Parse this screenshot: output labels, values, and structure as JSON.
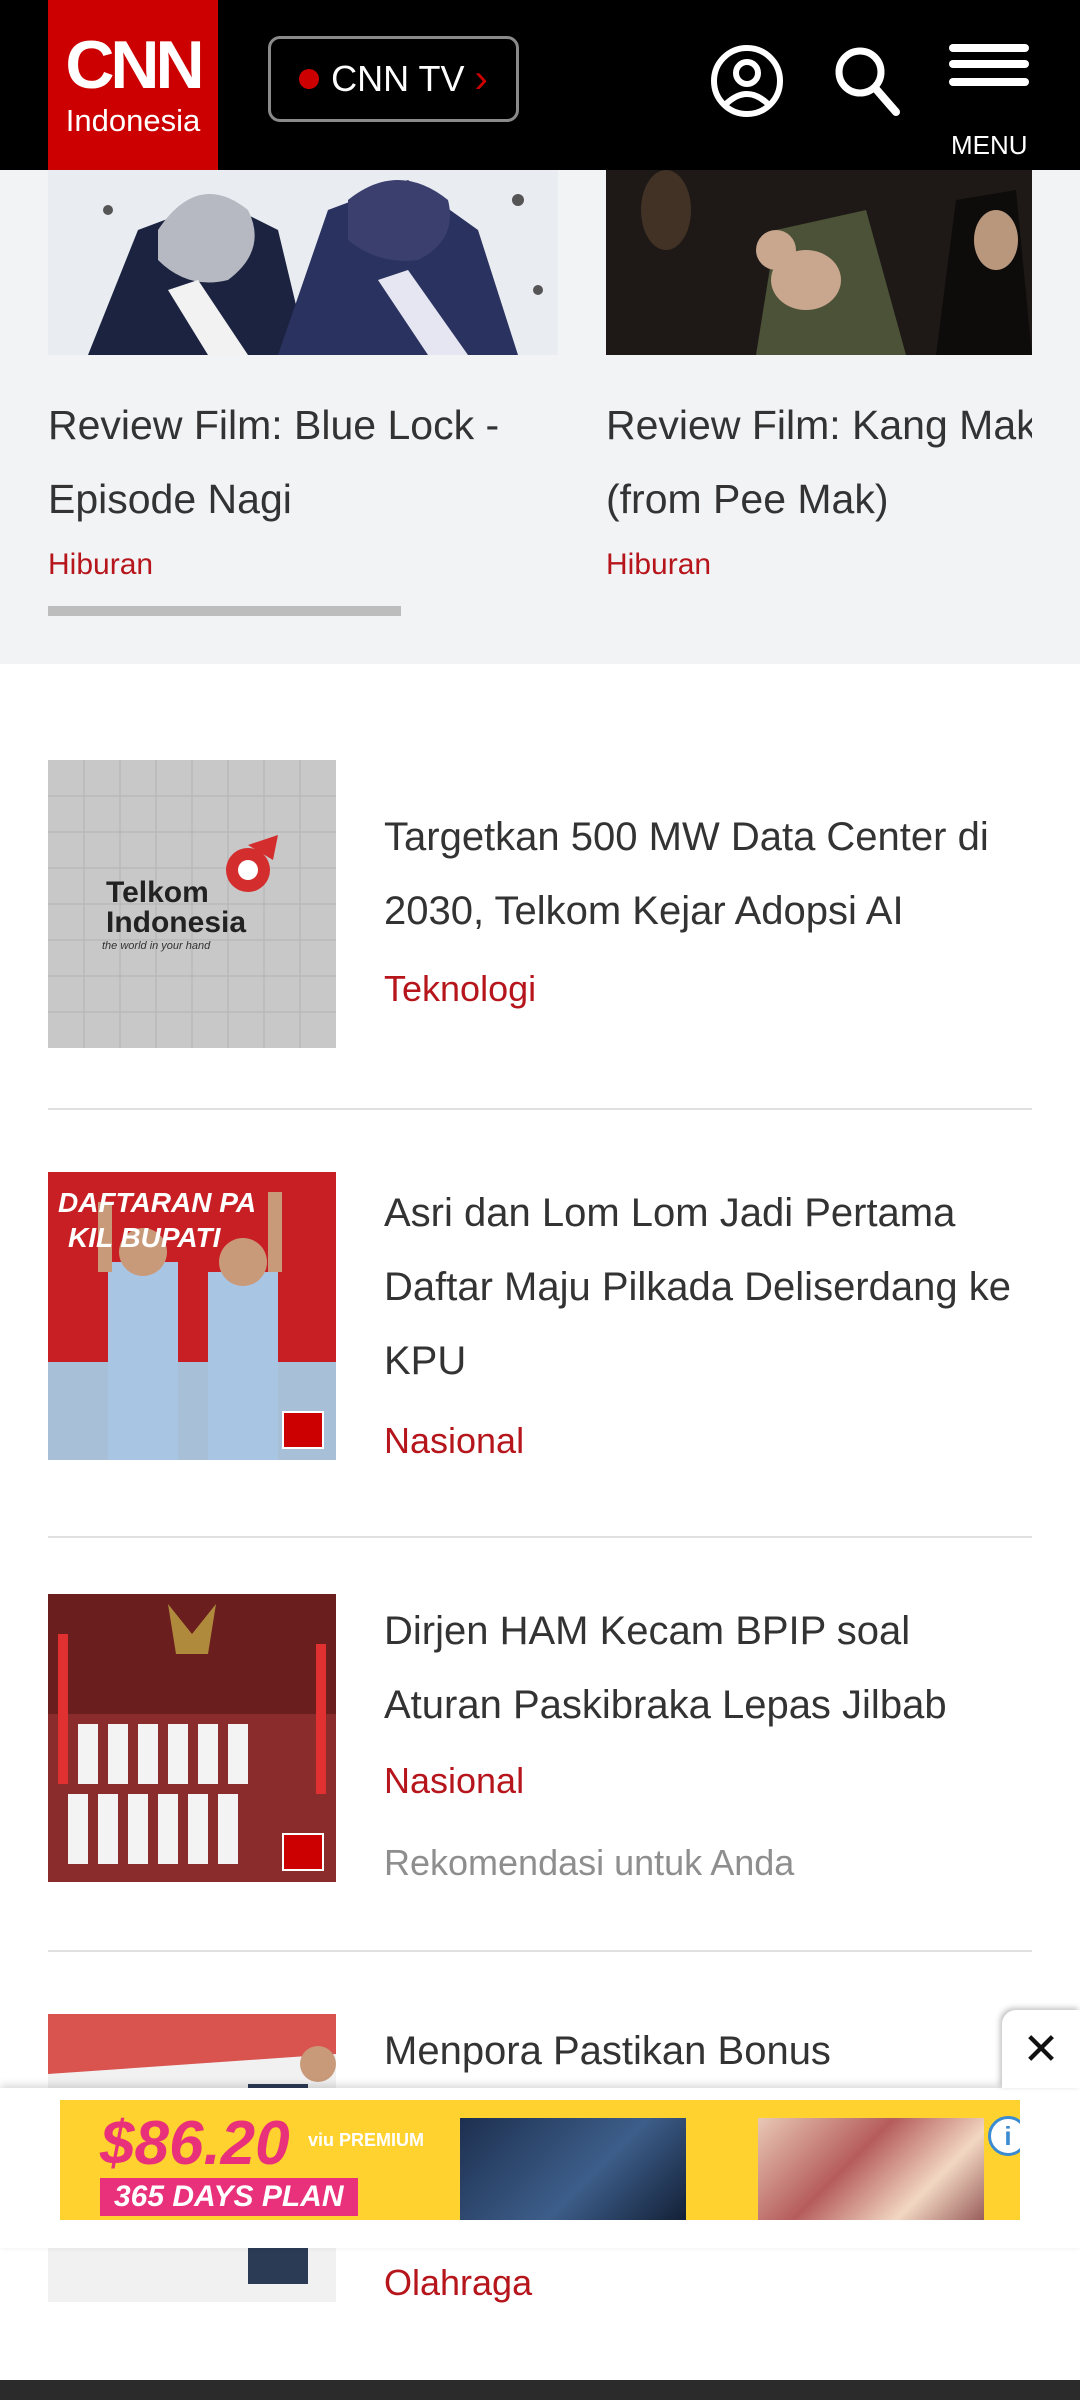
{
  "header": {
    "logo_main": "CNN",
    "logo_sub": "Indonesia",
    "cnntv_label": "CNN TV",
    "menu_label": "MENU"
  },
  "carousel": {
    "cards": [
      {
        "title_line1": "Review Film: Blue Lock -",
        "title_line2": "Episode Nagi",
        "category": "Hiburan"
      },
      {
        "title_line1": "Review Film: Kang Mak",
        "title_line2": "(from Pee Mak)",
        "category": "Hiburan"
      }
    ]
  },
  "news": [
    {
      "title": "Targetkan 500 MW Data Center di 2030, Telkom Kejar Adopsi AI",
      "category": "Teknologi",
      "thumb_text": "Telkom Indonesia",
      "thumb_caption": "the world in your hand"
    },
    {
      "title": "Asri dan Lom Lom Jadi Pertama Daftar Maju Pilkada Deliserdang ke KPU",
      "category": "Nasional"
    },
    {
      "title": "Dirjen HAM Kecam BPIP soal Aturan Paskibraka Lepas Jilbab",
      "category": "Nasional",
      "recommendation": "Rekomendasi untuk Anda"
    },
    {
      "title": "Menpora Pastikan Bonus",
      "category": "Olahraga"
    }
  ],
  "ad": {
    "price": "$86.20",
    "plan": "365 DAYS PLAN",
    "brand": "viu PREMIUM",
    "close_symbol": "✕",
    "dismiss_symbol": "✕",
    "info_symbol": "i"
  },
  "colors": {
    "brand_red": "#cc0000",
    "category_red": "#b5151b",
    "header_bg": "#000000",
    "carousel_bg": "#f2f3f5"
  }
}
